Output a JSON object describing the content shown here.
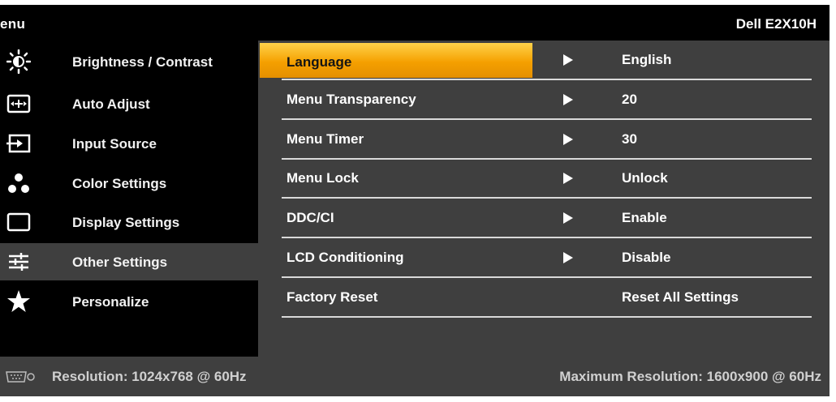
{
  "header": {
    "title": "enu",
    "model": "Dell E2X10H"
  },
  "sidebar": {
    "items": [
      {
        "label": "Brightness / Contrast",
        "icon": "brightness-icon"
      },
      {
        "label": "Auto Adjust",
        "icon": "auto-adjust-icon"
      },
      {
        "label": "Input Source",
        "icon": "input-source-icon"
      },
      {
        "label": "Color Settings",
        "icon": "color-settings-icon"
      },
      {
        "label": "Display Settings",
        "icon": "display-settings-icon"
      },
      {
        "label": "Other Settings",
        "icon": "other-settings-icon",
        "active": true
      },
      {
        "label": "Personalize",
        "icon": "star-icon"
      }
    ]
  },
  "settings": {
    "rows": [
      {
        "label": "Language",
        "value": "English",
        "selected": true
      },
      {
        "label": "Menu Transparency",
        "value": "20"
      },
      {
        "label": "Menu Timer",
        "value": "30"
      },
      {
        "label": "Menu Lock",
        "value": "Unlock"
      },
      {
        "label": "DDC/CI",
        "value": "Enable"
      },
      {
        "label": "LCD Conditioning",
        "value": "Disable"
      },
      {
        "label": "Factory Reset",
        "value": "Reset All Settings"
      }
    ]
  },
  "status": {
    "resolution": "Resolution: 1024x768 @ 60Hz",
    "max_resolution": "Maximum Resolution: 1600x900 @ 60Hz",
    "icon": "vga-connector-icon"
  },
  "colors": {
    "accent": "#f5a000",
    "panel": "#3f3f3f",
    "background": "#000000"
  }
}
